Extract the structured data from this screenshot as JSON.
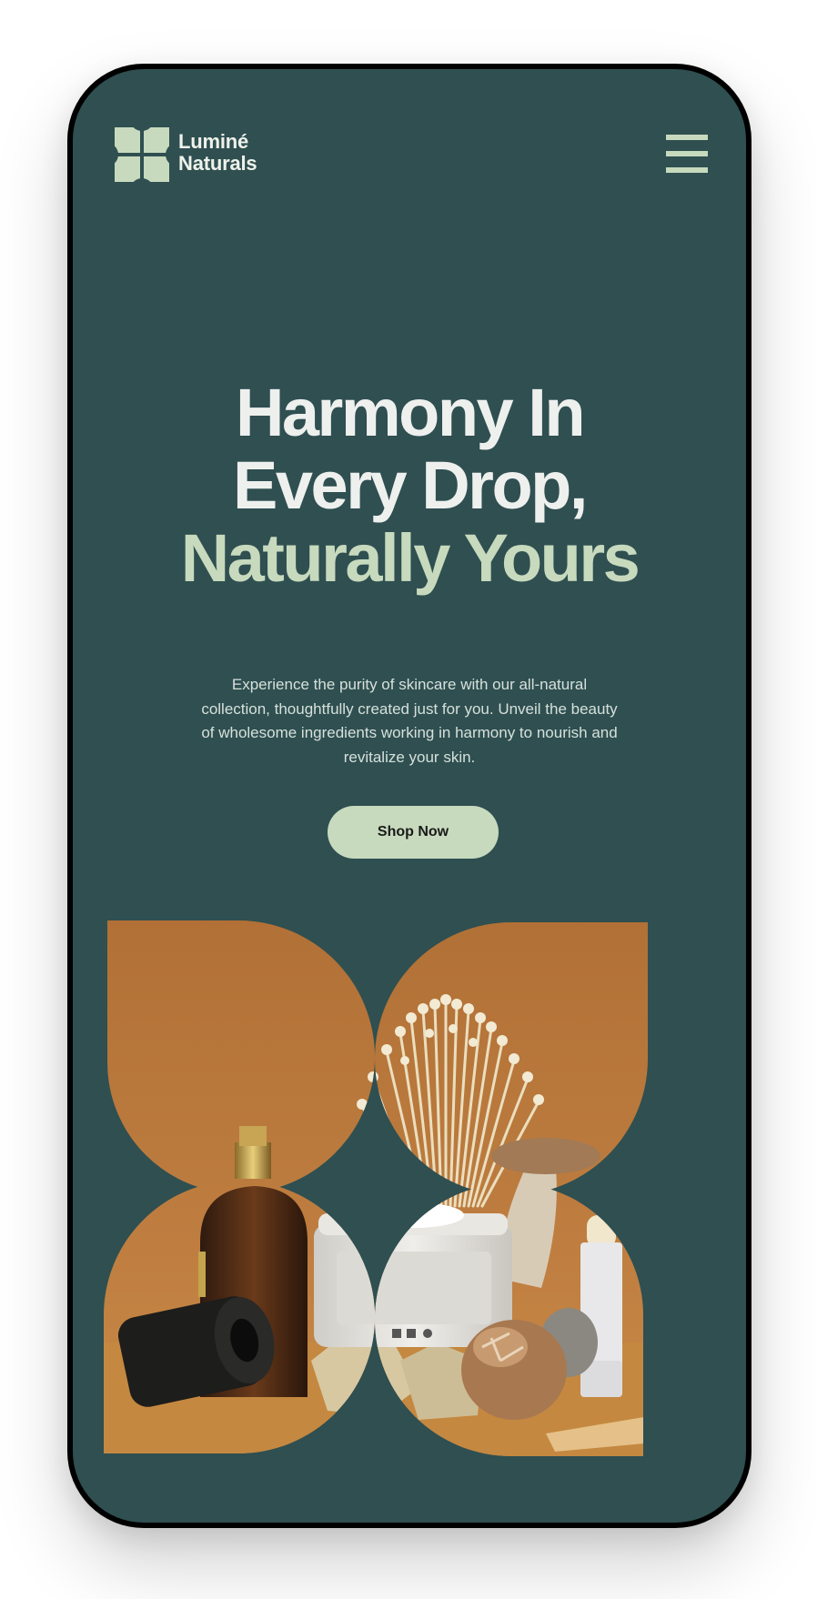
{
  "brand": {
    "line1": "Luminé",
    "line2": "Naturals",
    "logo_icon": "four-petal-flower-icon"
  },
  "nav": {
    "menu_icon": "hamburger-menu-icon"
  },
  "hero": {
    "title_line1": "Harmony In",
    "title_line2": "Every Drop,",
    "title_line3": "Naturally Yours",
    "description": "Experience the purity of skincare with our all-natural collection, thoughtfully created just for you. Unveil the beauty of wholesome ingredients working in harmony to nourish and revitalize your skin.",
    "cta_label": "Shop Now"
  },
  "colors": {
    "background": "#2f4f51",
    "accent": "#c7dabd",
    "heading": "#eef0ee",
    "photo_backdrop": "#b9773a"
  }
}
